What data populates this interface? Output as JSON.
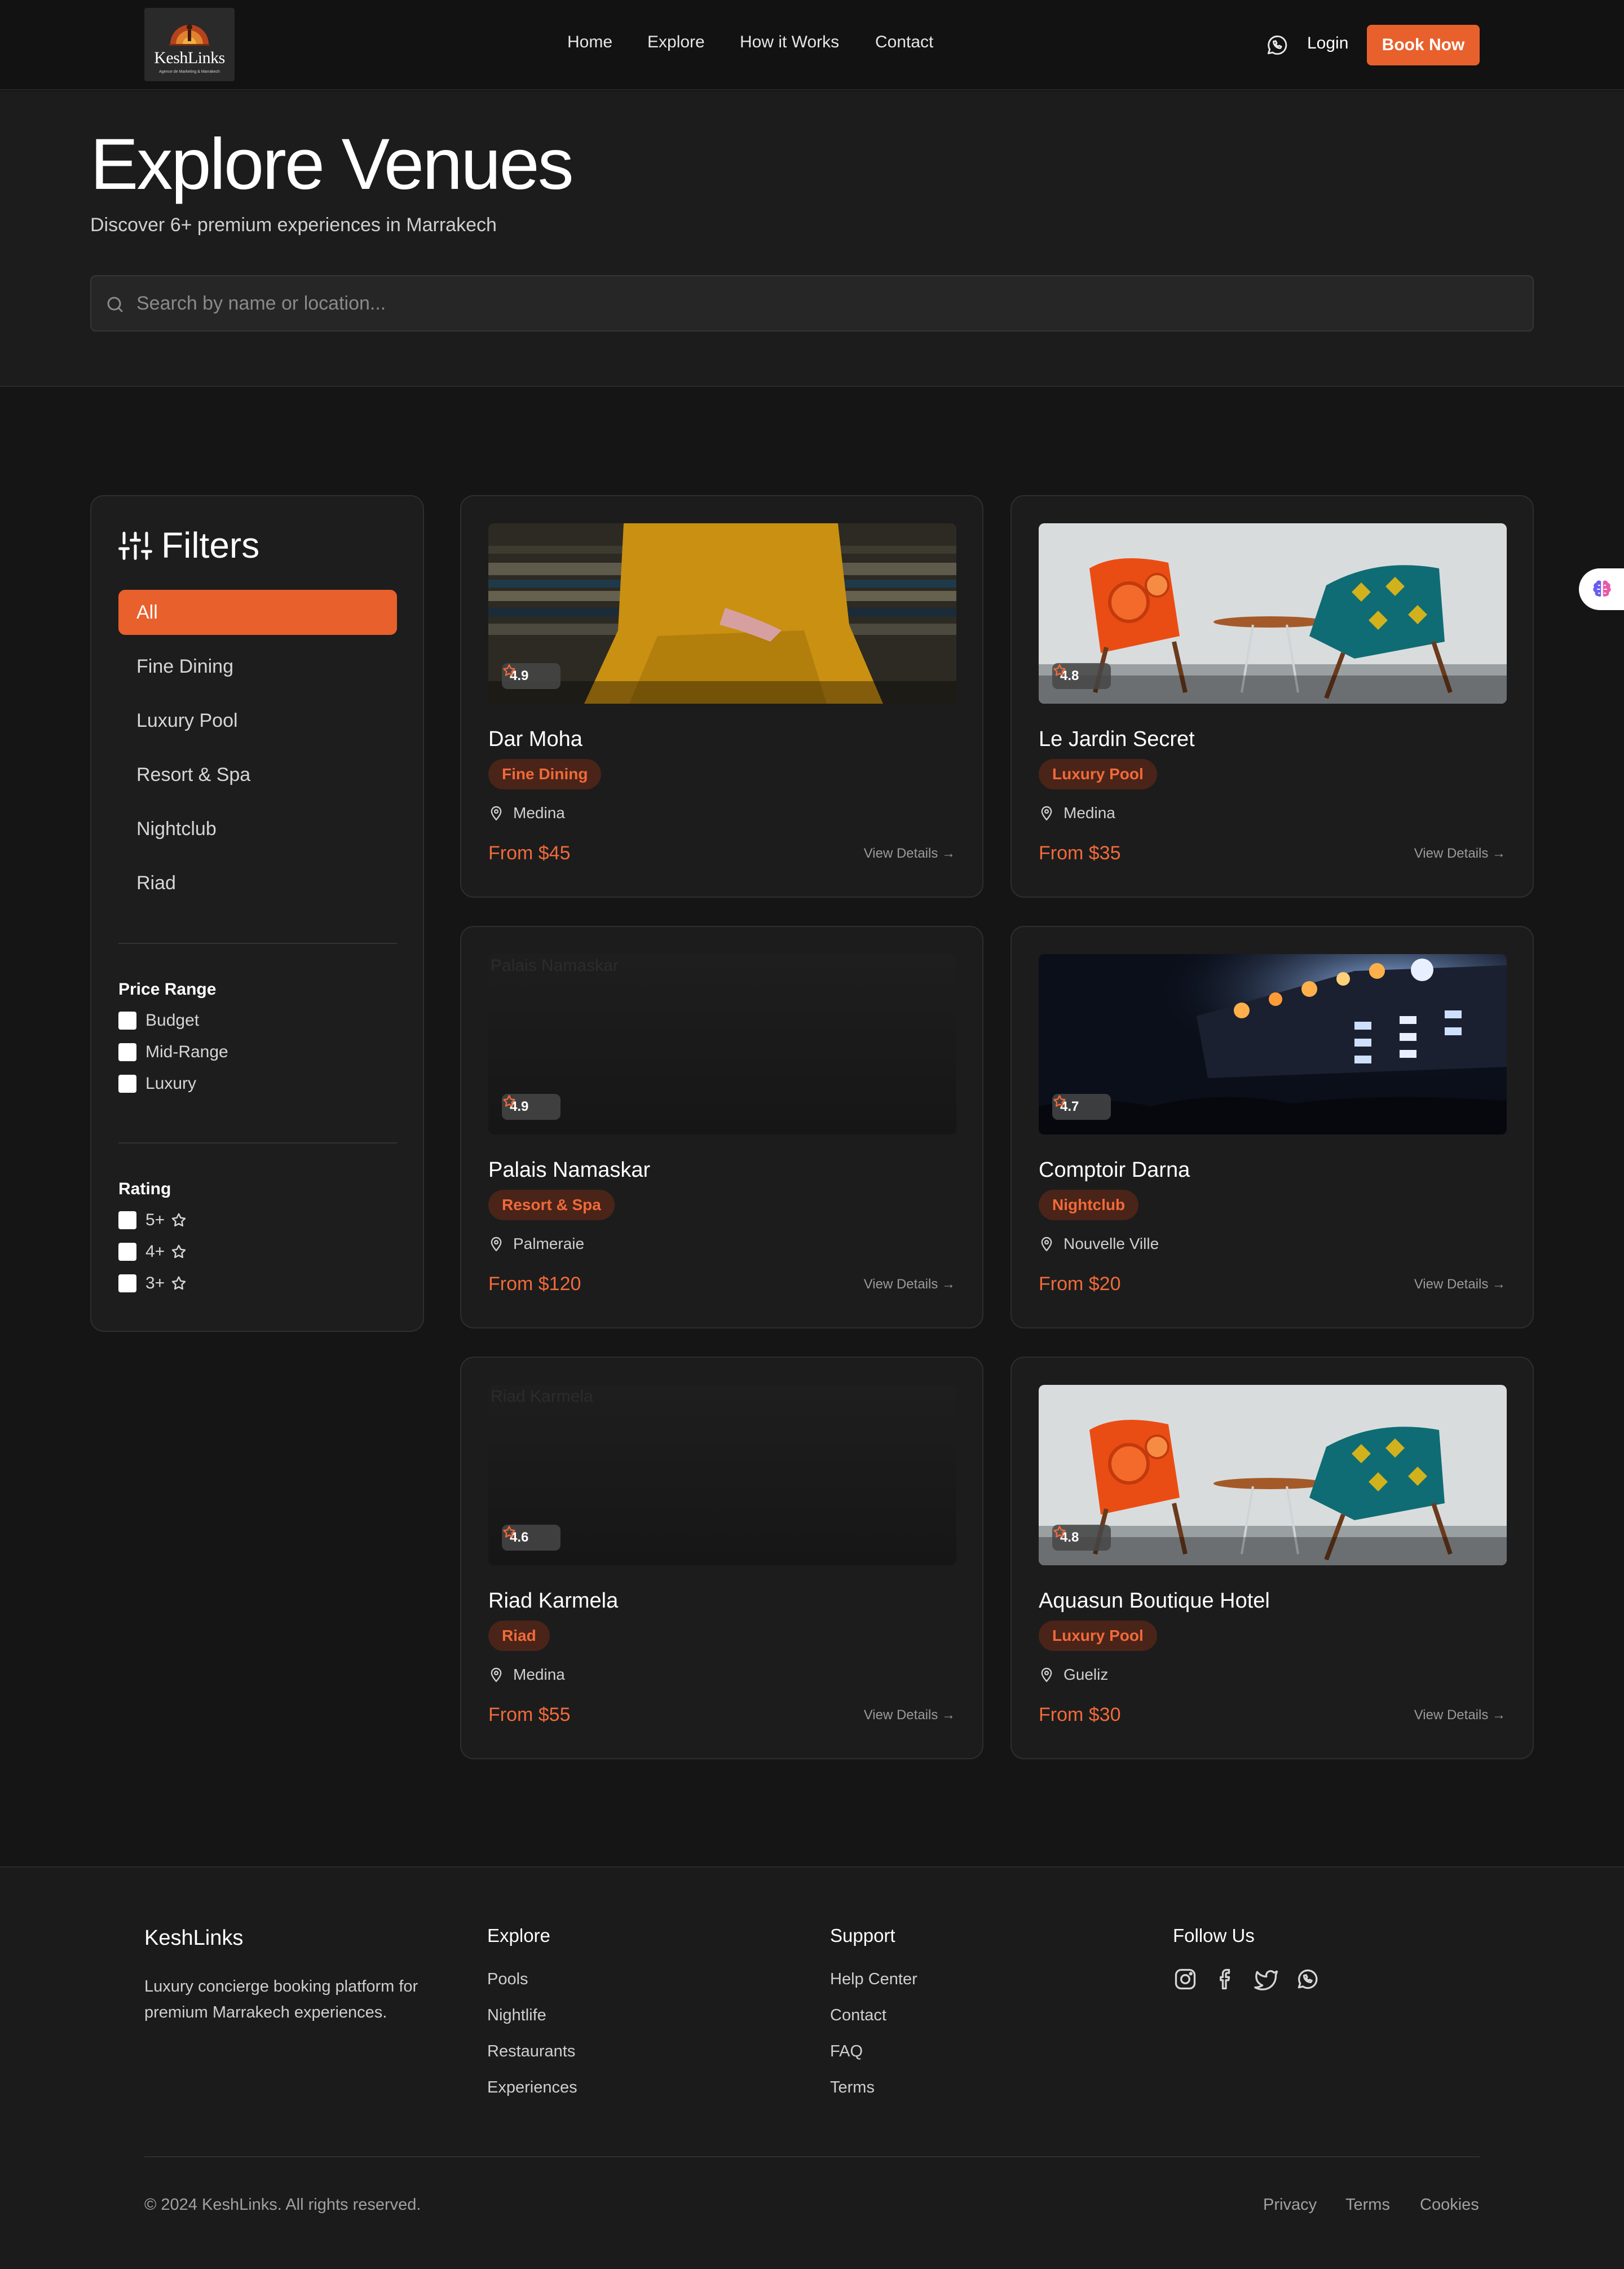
{
  "header": {
    "logo_name": "KeshLinks",
    "logo_tagline": "Agence de Marketing & Marrakech",
    "nav": [
      "Home",
      "Explore",
      "How it Works",
      "Contact"
    ],
    "login": "Login",
    "book_now": "Book Now"
  },
  "hero": {
    "title": "Explore Venues",
    "subtitle": "Discover 6+ premium experiences in Marrakech",
    "search_placeholder": "Search by name or location..."
  },
  "filters": {
    "title": "Filters",
    "categories": [
      "All",
      "Fine Dining",
      "Luxury Pool",
      "Resort & Spa",
      "Nightclub",
      "Riad"
    ],
    "active_category": "All",
    "price_range": {
      "title": "Price Range",
      "options": [
        "Budget",
        "Mid-Range",
        "Luxury"
      ]
    },
    "rating": {
      "title": "Rating",
      "options": [
        "5+",
        "4+",
        "3+"
      ]
    }
  },
  "venues": [
    {
      "name": "Dar Moha",
      "category": "Fine Dining",
      "location": "Medina",
      "price": "From $45",
      "rating": "4.9",
      "image": "woman-yellow-dress",
      "view": "View Details →"
    },
    {
      "name": "Le Jardin Secret",
      "category": "Luxury Pool",
      "location": "Medina",
      "price": "From $35",
      "rating": "4.8",
      "image": "two-armchairs",
      "view": "View Details →"
    },
    {
      "name": "Palais Namaskar",
      "category": "Resort & Spa",
      "location": "Palmeraie",
      "price": "From $120",
      "rating": "4.9",
      "image": "broken",
      "alt": "Palais Namaskar",
      "view": "View Details →"
    },
    {
      "name": "Comptoir Darna",
      "category": "Nightclub",
      "location": "Nouvelle Ville",
      "price": "From $20",
      "rating": "4.7",
      "image": "concert-stage",
      "view": "View Details →"
    },
    {
      "name": "Riad Karmela",
      "category": "Riad",
      "location": "Medina",
      "price": "From $55",
      "rating": "4.6",
      "image": "broken",
      "alt": "Riad Karmela",
      "view": "View Details →"
    },
    {
      "name": "Aquasun Boutique Hotel",
      "category": "Luxury Pool",
      "location": "Gueliz",
      "price": "From $30",
      "rating": "4.8",
      "image": "two-armchairs",
      "view": "View Details →"
    }
  ],
  "footer": {
    "brand": "KeshLinks",
    "description": "Luxury concierge booking platform for premium Marrakech experiences.",
    "explore": {
      "title": "Explore",
      "links": [
        "Pools",
        "Nightlife",
        "Restaurants",
        "Experiences"
      ]
    },
    "support": {
      "title": "Support",
      "links": [
        "Help Center",
        "Contact",
        "FAQ",
        "Terms"
      ]
    },
    "follow": {
      "title": "Follow Us",
      "icons": [
        "instagram-icon",
        "facebook-icon",
        "twitter-icon",
        "whatsapp-icon"
      ]
    },
    "copyright": "© 2024 KeshLinks. All rights reserved.",
    "legal": [
      "Privacy",
      "Terms",
      "Cookies"
    ]
  },
  "colors": {
    "accent": "#e8602c",
    "background": "#151515",
    "card": "#1c1c1c",
    "tag_bg": "#4a2418",
    "tag_text": "#f06a3a"
  }
}
